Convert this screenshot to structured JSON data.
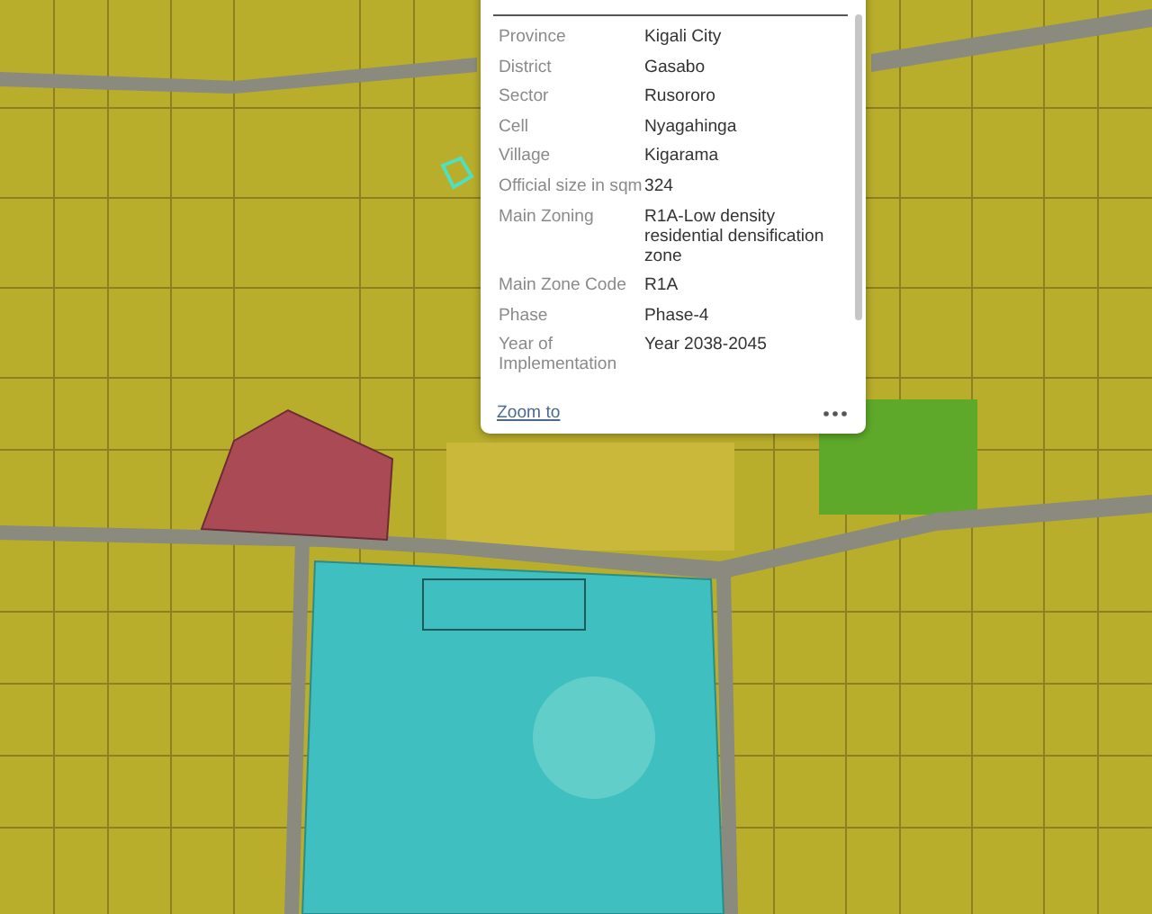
{
  "popup": {
    "rows": [
      {
        "label": "Province",
        "value": "Kigali City"
      },
      {
        "label": "District",
        "value": "Gasabo"
      },
      {
        "label": "Sector",
        "value": "Rusororo"
      },
      {
        "label": "Cell",
        "value": "Nyagahinga"
      },
      {
        "label": "Village",
        "value": "Kigarama"
      },
      {
        "label": "Official size in sqm",
        "value": "324"
      },
      {
        "label": "Main Zoning",
        "value": "R1A-Low density residential densification zone"
      },
      {
        "label": "Main Zone Code",
        "value": "R1A"
      },
      {
        "label": "Phase",
        "value": "Phase-4"
      },
      {
        "label": "Year of Implementation",
        "value": "Year 2038-2045"
      }
    ],
    "zoom_link": "Zoom to"
  }
}
